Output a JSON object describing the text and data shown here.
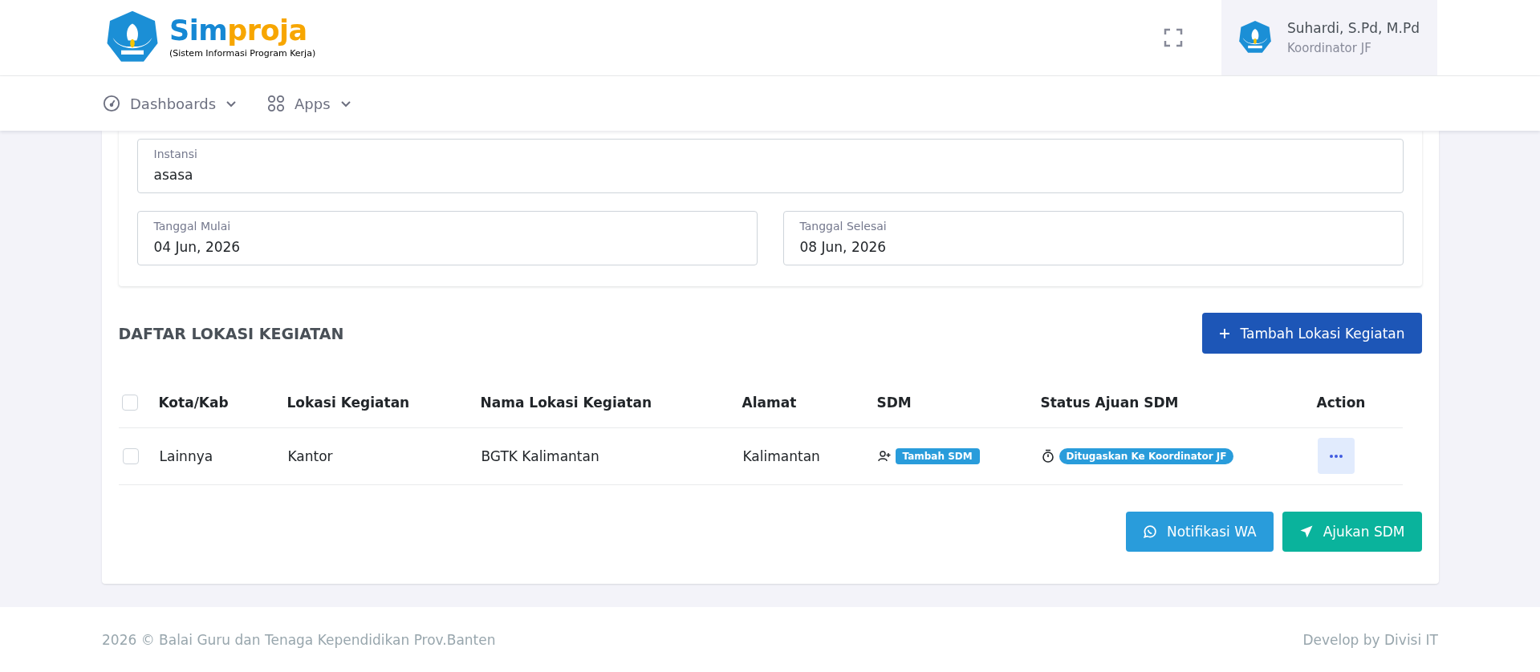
{
  "header": {
    "brand": {
      "first": "Sim",
      "second": "proja",
      "subtitle": "(Sistem Informasi Program Kerja)"
    },
    "user": {
      "name": "Suhardi, S.Pd, M.Pd",
      "role": "Koordinator JF"
    }
  },
  "nav": [
    {
      "label": "Dashboards",
      "kind": "gauge"
    },
    {
      "label": "Apps",
      "kind": "grid"
    }
  ],
  "form": {
    "fields": [
      {
        "label": "Instansi",
        "value": "asasa",
        "kind": "wide"
      },
      {
        "label": "Tanggal Mulai",
        "value": "04 Jun, 2026",
        "kind": "half"
      },
      {
        "label": "Tanggal Selesai",
        "value": "08 Jun, 2026",
        "kind": "half"
      }
    ]
  },
  "section": {
    "title": "DAFTAR LOKASI KEGIATAN",
    "add_button": "Tambah Lokasi Kegiatan"
  },
  "table": {
    "select_all": {
      "checked": false
    },
    "columns": [
      "Kota/Kab",
      "Lokasi Kegiatan",
      "Nama Lokasi Kegiatan",
      "Alamat",
      "SDM",
      "Status Ajuan SDM",
      "Action"
    ],
    "rows": [
      {
        "checked": false,
        "cells": [
          "Lainnya",
          "Kantor",
          "BGTK Kalimantan",
          "Kalimantan"
        ],
        "sdm_badge": "Tambah SDM",
        "status": "Ditugaskan Ke Koordinator JF"
      }
    ]
  },
  "actions": [
    {
      "label": "Notifikasi WA",
      "kind": "whatsapp"
    },
    {
      "label": "Ajukan SDM",
      "kind": "send"
    }
  ],
  "footer": {
    "left": "2026 © Balai Guru dan Tenaga Kependidikan Prov.Banten",
    "right": "Develop by Divisi IT"
  }
}
